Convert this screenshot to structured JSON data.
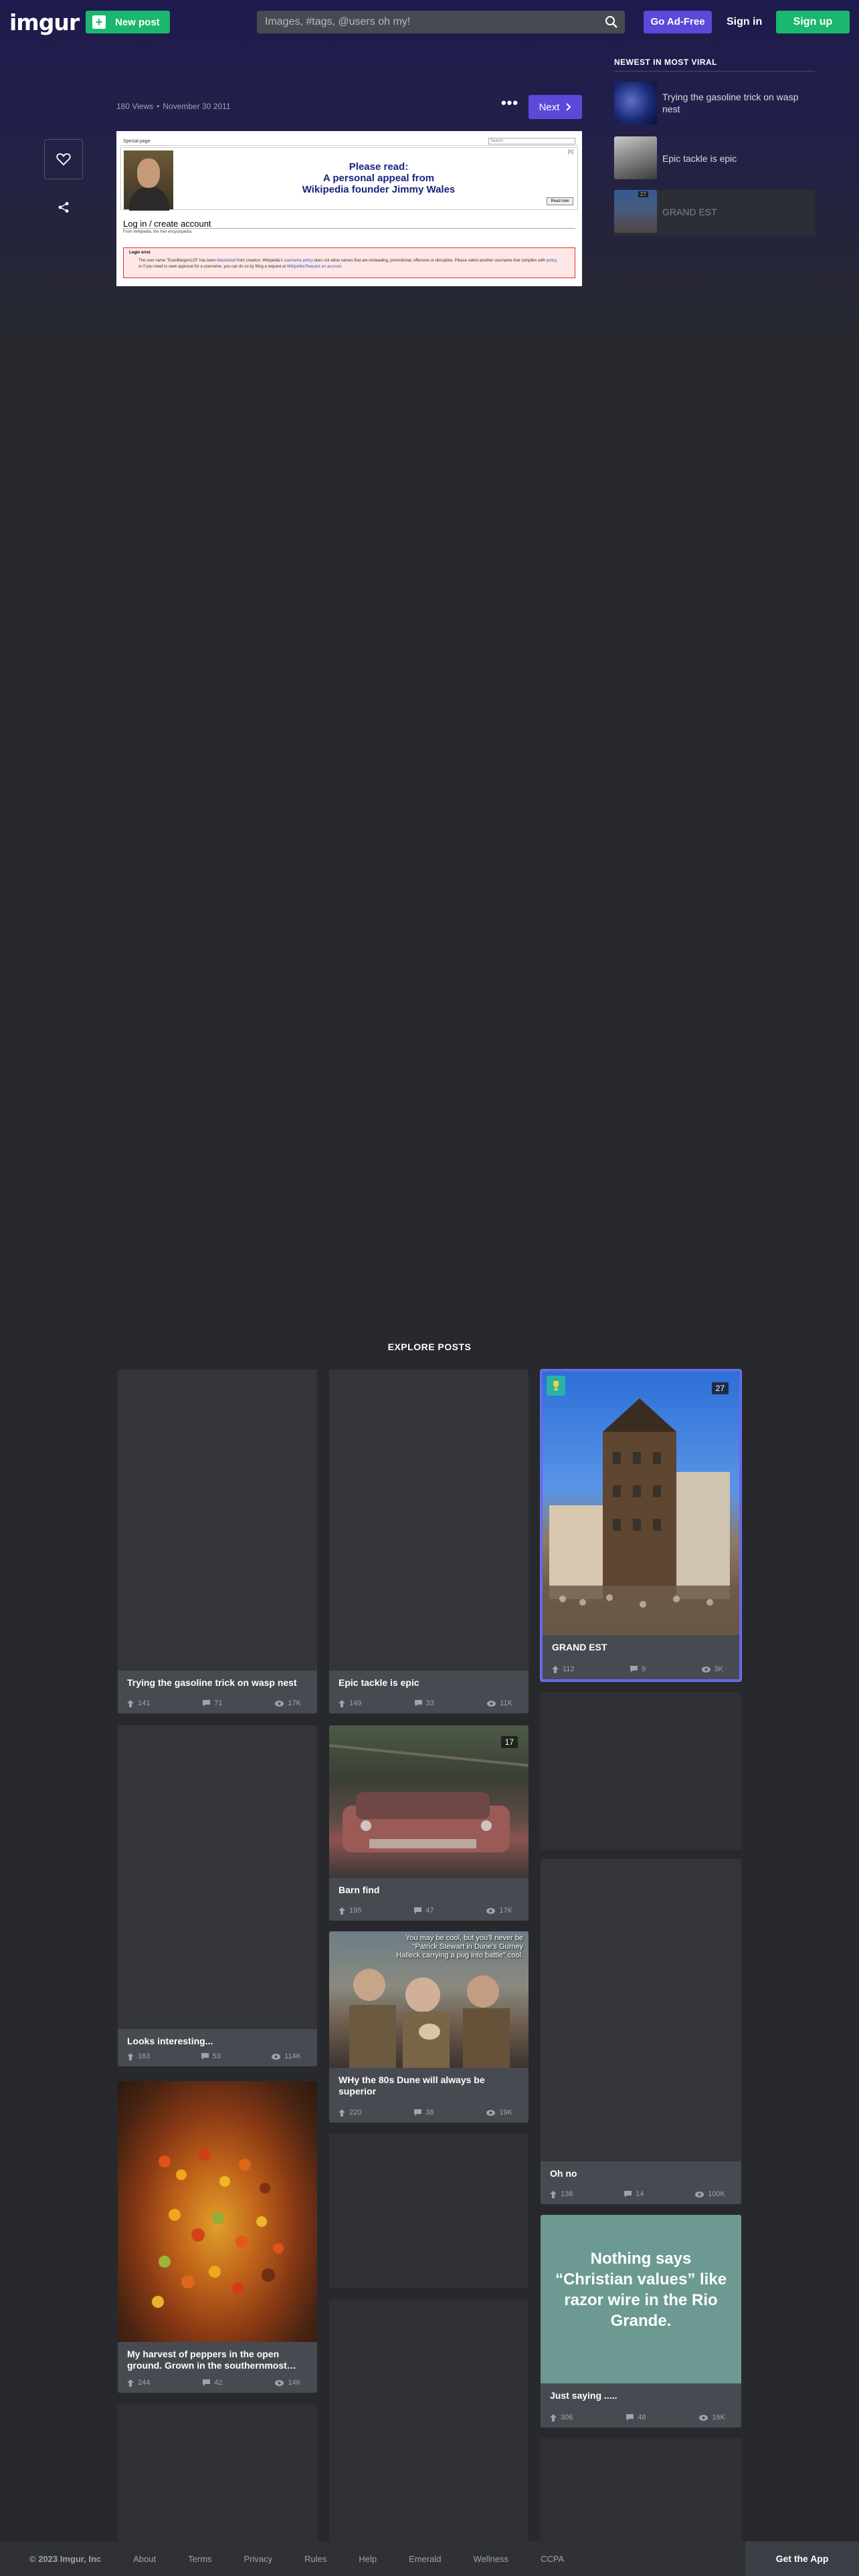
{
  "header": {
    "logo": "imgur",
    "new_post": "New post",
    "search_placeholder": "Images, #tags, @users oh my!",
    "go_adfree": "Go Ad-Free",
    "sign_in": "Sign in",
    "sign_up": "Sign up"
  },
  "post": {
    "views": "180 Views",
    "date": "November 30 2011",
    "more": "•••",
    "next": "Next",
    "image": {
      "special_page": "Special page",
      "search_box": "Search",
      "appeal_line1": "Please read:",
      "appeal_line2": "A personal appeal from",
      "appeal_line3": "Wikipedia founder Jimmy Wales",
      "read_now": "Read now",
      "close": "[X]",
      "login_heading": "Log in / create account",
      "from": "From Wikipedia, the free encyclopedia",
      "error_title": "Login error",
      "error_text_1": "The user name \"EvanBergen123\" has been",
      "error_link_1": "blacklisted",
      "error_text_2": "from creation. Wikipedia's",
      "error_link_2": "username policy",
      "error_text_3": "does not allow names that are misleading, promotional, offensive or disruptive. Please select another username that complies with",
      "error_link_3": "policy",
      "error_text_4": ", or if you need to seek approval for a username, you can do so by filing a request at",
      "error_link_4": "Wikipedia:Request an account",
      "error_text_5": "."
    }
  },
  "sidebar": {
    "title": "NEWEST IN MOST VIRAL",
    "items": [
      {
        "label": "Trying the gasoline trick on wasp nest"
      },
      {
        "label": "Epic tackle is epic"
      },
      {
        "label": "GRAND EST",
        "badge": "27"
      }
    ]
  },
  "explore": {
    "title": "EXPLORE POSTS",
    "cards": [
      {
        "title": "Trying the gasoline trick on wasp nest",
        "ups": "141",
        "comments": "71",
        "views": "17K"
      },
      {
        "title": "Epic tackle is epic",
        "ups": "149",
        "comments": "33",
        "views": "11K"
      },
      {
        "title": "GRAND EST",
        "ups": "112",
        "comments": "9",
        "views": "3K",
        "badge": "27"
      },
      {
        "title": "Barn find",
        "ups": "195",
        "comments": "47",
        "views": "17K",
        "badge": "17"
      },
      {
        "title": "Looks interesting...",
        "ups": "163",
        "comments": "53",
        "views": "114K"
      },
      {
        "title": "WHy the 80s Dune will always be superior",
        "ups": "220",
        "comments": "38",
        "views": "19K",
        "caption": "You may be cool, but you'll never be \"Patrick Stewart in Dune's Gurney Halleck carrying a pug into battle\" cool."
      },
      {
        "title": "Oh no",
        "ups": "138",
        "comments": "14",
        "views": "100K"
      },
      {
        "title": "My harvest of peppers in the open ground. Grown in the southernmost…",
        "ups": "244",
        "comments": "42",
        "views": "14K"
      },
      {
        "title": "Just saying .....",
        "ups": "306",
        "comments": "48",
        "views": "16K",
        "image_text": "Nothing says “Christian values” like razor wire in the Rio Grande."
      }
    ]
  },
  "footer": {
    "copyright": "© 2023 Imgur, Inc",
    "links": [
      "About",
      "Terms",
      "Privacy",
      "Rules",
      "Help",
      "Emerald",
      "Wellness",
      "CCPA"
    ],
    "get_app": "Get the App"
  },
  "colors": {
    "accent_green": "#1bb76e",
    "accent_purple": "#5c49d9",
    "background": "#27292d",
    "header_gradient": "#1e1a4d"
  }
}
